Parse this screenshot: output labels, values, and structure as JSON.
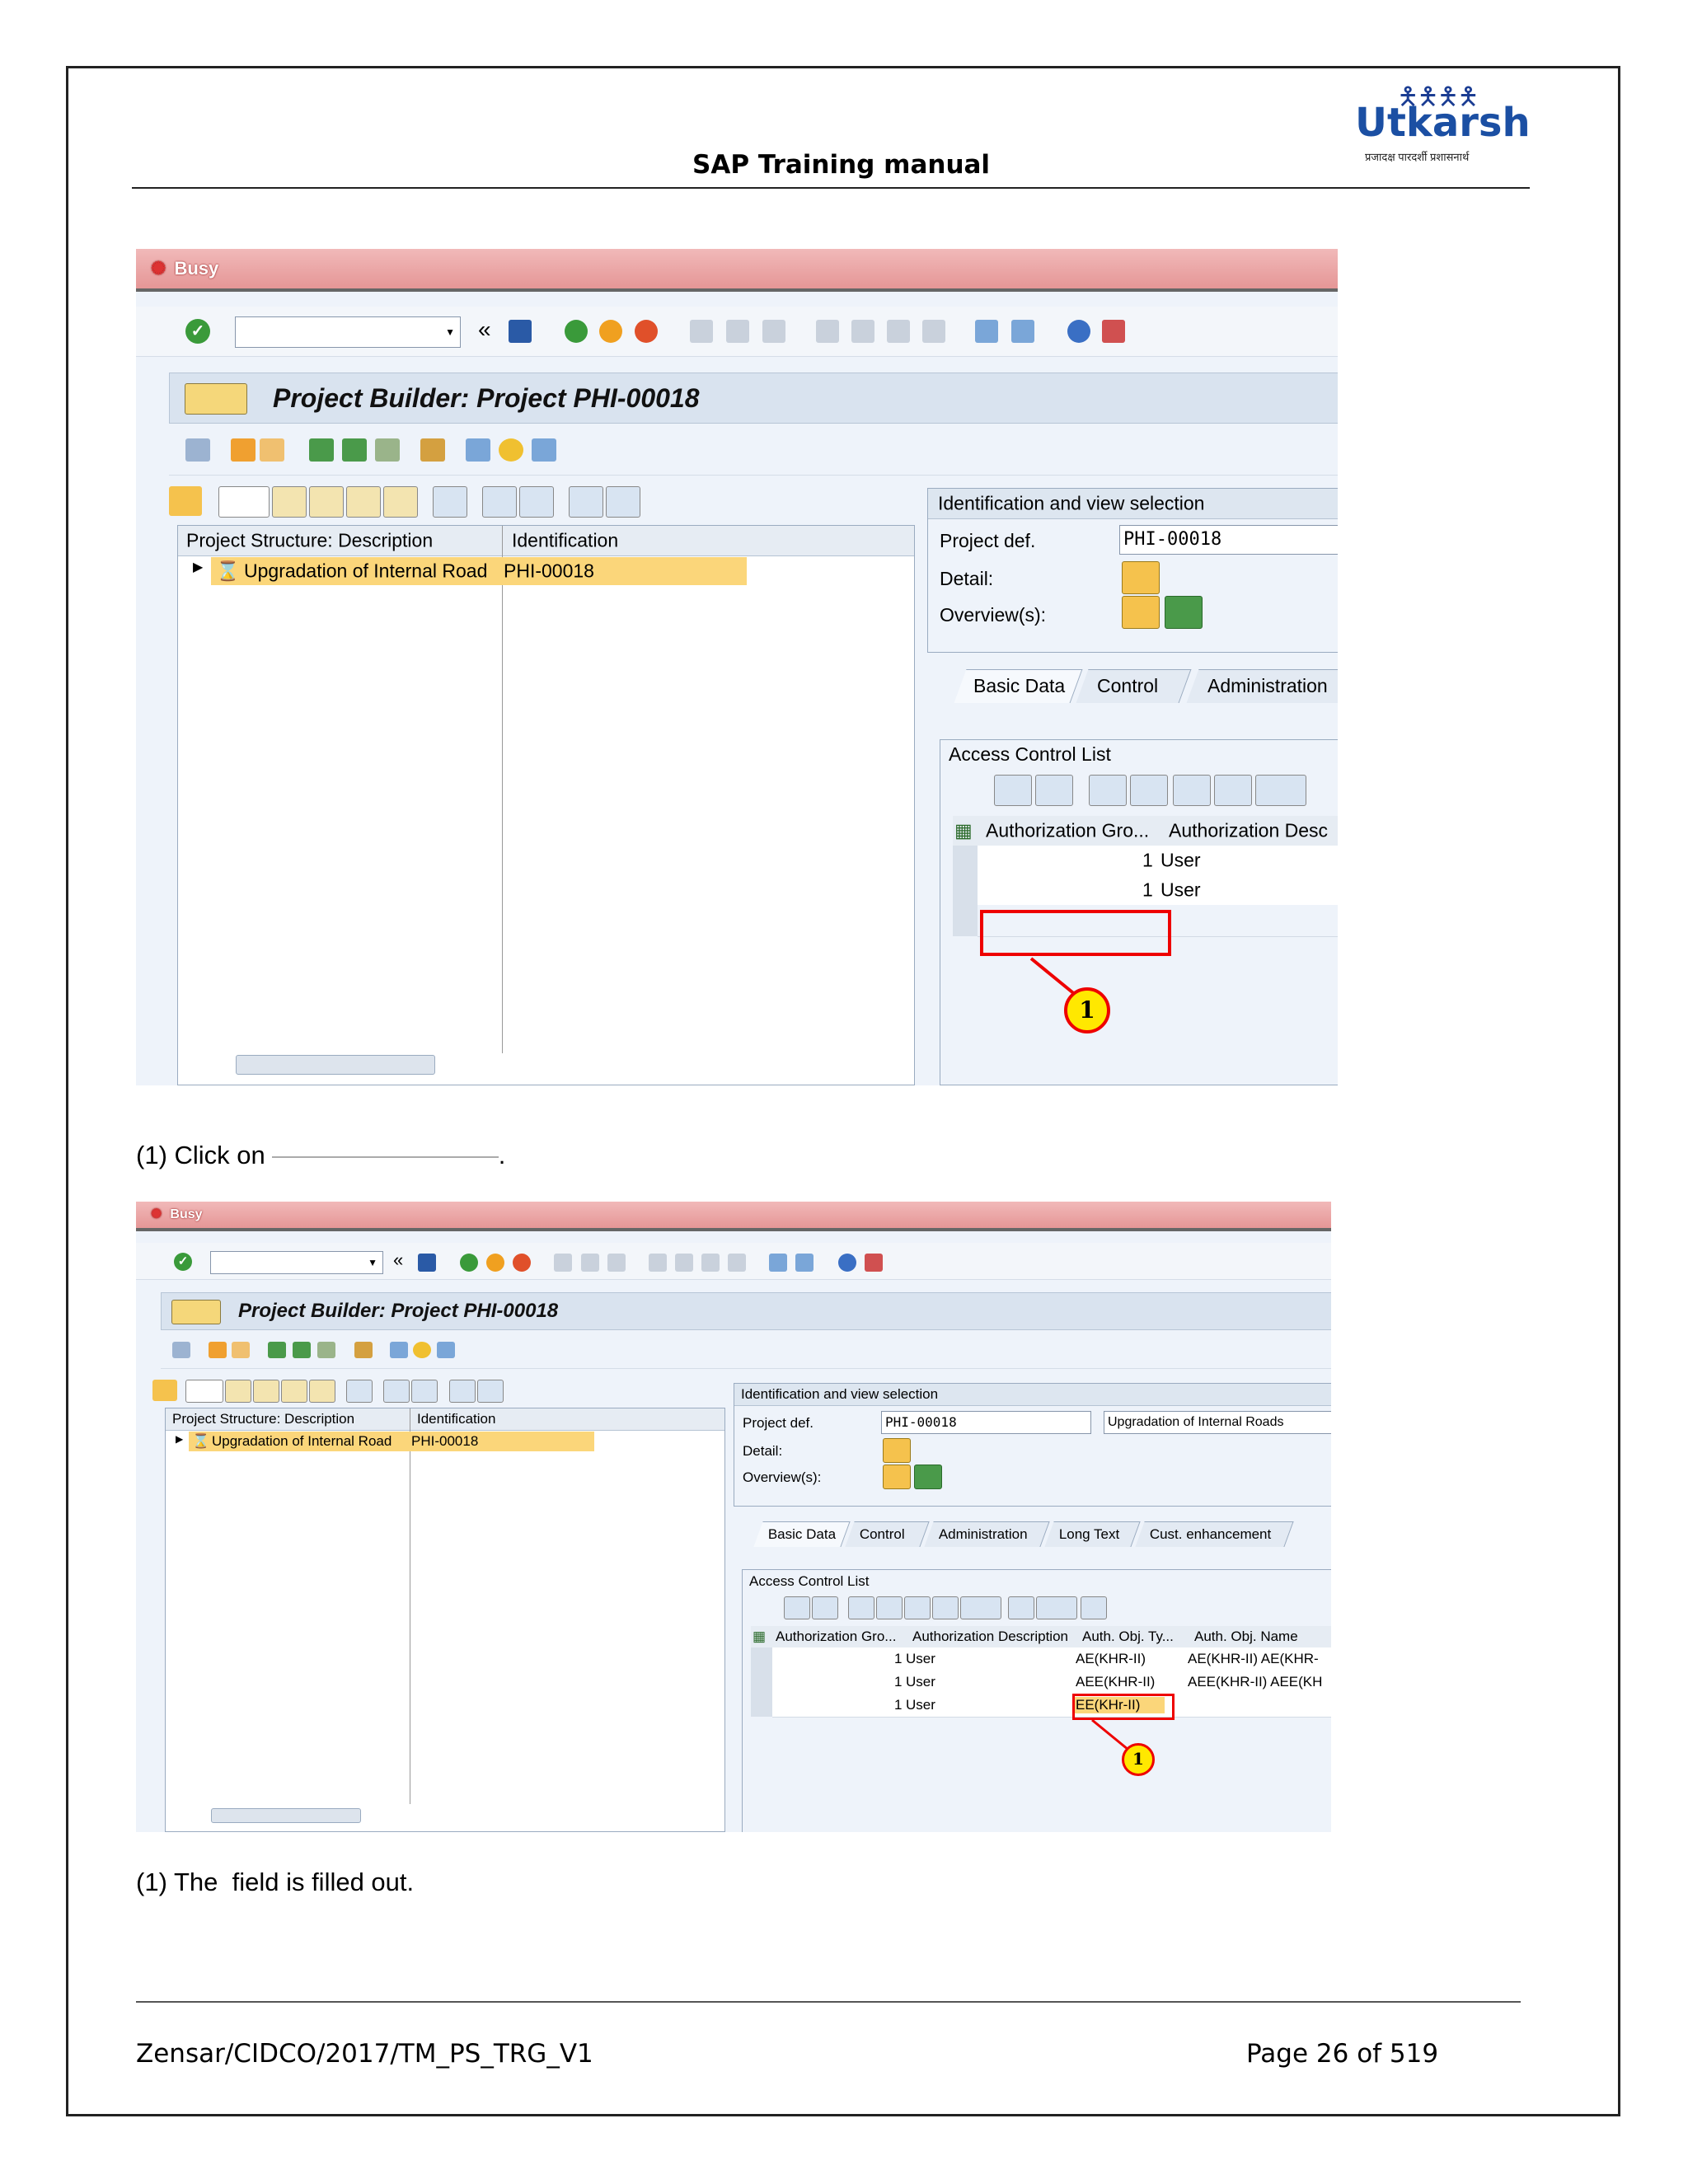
{
  "header": {
    "title": "SAP Training manual",
    "logo_word": "Utkarsh",
    "logo_tagline": "प्रजादक्ष पारदर्शी प्रशासनार्थ"
  },
  "shot1": {
    "busy_label": "Busy",
    "window_title": "Project Builder: Project PHI-00018",
    "tree_col_desc": "Project Structure: Description",
    "tree_col_id": "Identification",
    "tree_row_desc": "Upgradation of Internal Road",
    "tree_row_id": "PHI-00018",
    "ident_title": "Identification and view selection",
    "project_def_label": "Project def.",
    "project_def_value": "PHI-00018",
    "detail_label": "Detail:",
    "overview_label": "Overview(s):",
    "tabs": [
      "Basic Data",
      "Control",
      "Administration"
    ],
    "acl_title": "Access Control List",
    "acl_col1": "Authorization Gro...",
    "acl_col2": "Authorization Desc",
    "acl_rows": [
      {
        "group": "1",
        "desc": "User"
      },
      {
        "group": "1",
        "desc": "User"
      }
    ],
    "callout": "1"
  },
  "caption1": {
    "text": "(1) Click on",
    "end": "."
  },
  "shot2": {
    "busy_label": "Busy",
    "window_title": "Project Builder: Project PHI-00018",
    "tree_col_desc": "Project Structure: Description",
    "tree_col_id": "Identification",
    "tree_row_desc": "Upgradation of Internal Road",
    "tree_row_id": "PHI-00018",
    "ident_title": "Identification and view selection",
    "project_def_label": "Project def.",
    "project_def_value": "PHI-00018",
    "project_def_desc": "Upgradation of Internal Roads",
    "detail_label": "Detail:",
    "overview_label": "Overview(s):",
    "tabs": [
      "Basic Data",
      "Control",
      "Administration",
      "Long Text",
      "Cust. enhancement"
    ],
    "acl_title": "Access Control List",
    "acl_cols": [
      "Authorization Gro...",
      "Authorization Description",
      "Auth. Obj. Ty...",
      "Auth. Obj. Name"
    ],
    "acl_rows": [
      {
        "group": "1",
        "desc": "User",
        "type": "AE(KHR-II)",
        "name": "AE(KHR-II) AE(KHR-"
      },
      {
        "group": "1",
        "desc": "User",
        "type": "AEE(KHR-II)",
        "name": "AEE(KHR-II) AEE(KH"
      },
      {
        "group": "1",
        "desc": "User",
        "type": "EE(KHr-II)",
        "name": ""
      }
    ],
    "callout": "1"
  },
  "caption2": {
    "text": "(1) The  field is filled out."
  },
  "footer": {
    "doc_id": "Zensar/CIDCO/2017/TM_PS_TRG_V1",
    "page": "Page 26 of 519"
  }
}
